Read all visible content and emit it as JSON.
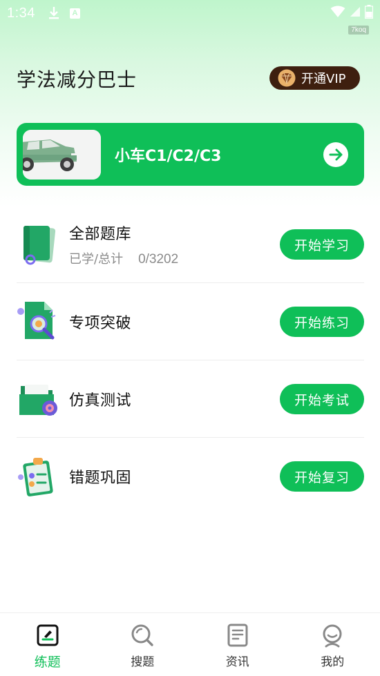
{
  "status_bar": {
    "time": "1:34",
    "icons": [
      "download-icon",
      "a-badge-icon",
      "wifi-icon",
      "cellular-icon",
      "battery-icon"
    ]
  },
  "watermark": "7koq",
  "header": {
    "title": "学法减分巴士",
    "vip_label": "开通VIP"
  },
  "car_card": {
    "label": "小车C1/C2/C3",
    "thumb_icon": "car-icon",
    "arrow_icon": "arrow-right-icon"
  },
  "rows": [
    {
      "title": "全部题库",
      "sub_label": "已学/总计",
      "sub_value": "0/3202",
      "button": "开始学习",
      "icon": "question-bank-icon"
    },
    {
      "title": "专项突破",
      "button": "开始练习",
      "icon": "magnifier-doc-icon"
    },
    {
      "title": "仿真测试",
      "button": "开始考试",
      "icon": "folder-exam-icon"
    },
    {
      "title": "错题巩固",
      "button": "开始复习",
      "icon": "clipboard-icon"
    }
  ],
  "tabbar": {
    "tabs": [
      {
        "label": "练题",
        "icon": "edit-icon",
        "active": true
      },
      {
        "label": "搜题",
        "icon": "search-icon",
        "active": false
      },
      {
        "label": "资讯",
        "icon": "news-icon",
        "active": false
      },
      {
        "label": "我的",
        "icon": "profile-icon",
        "active": false
      }
    ]
  },
  "colors": {
    "accent": "#0fbf58",
    "vip_bg": "#3e1f0f",
    "header_gradient_top": "#bff5cc"
  }
}
